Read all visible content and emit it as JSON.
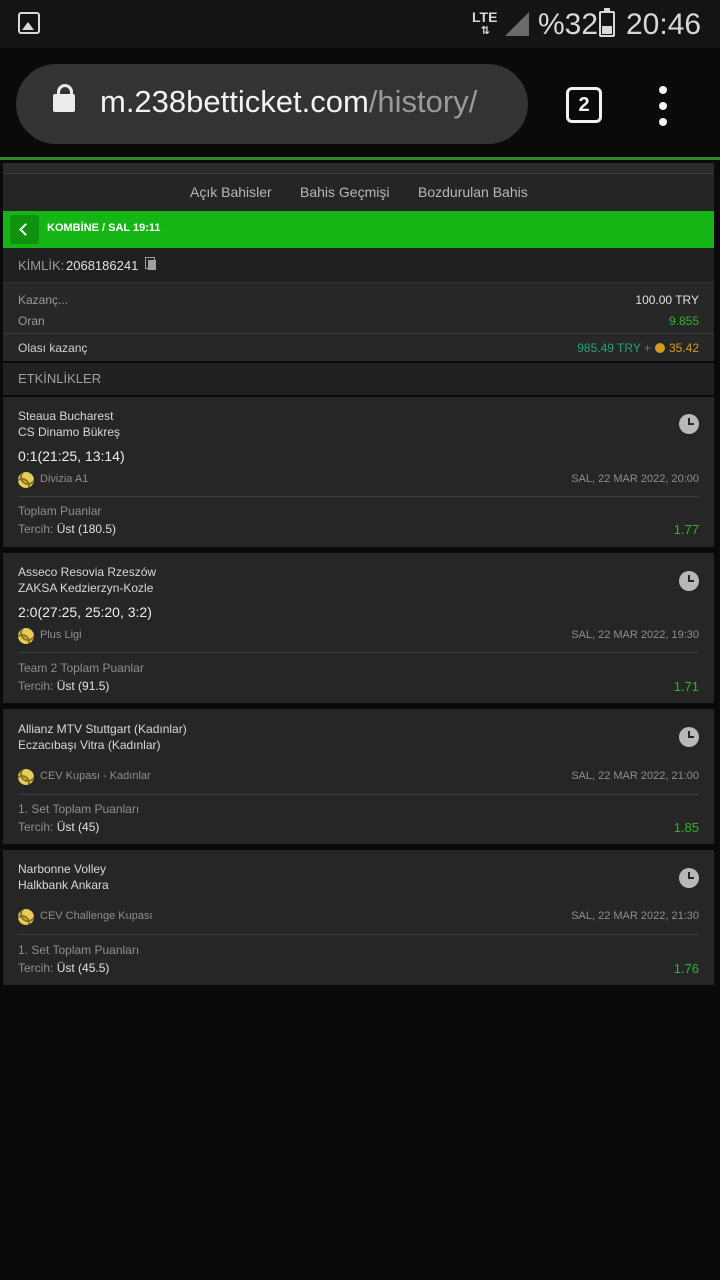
{
  "status_bar": {
    "network": "LTE",
    "battery": "%32",
    "time": "20:46",
    "icons": [
      "image-icon",
      "data-arrows-icon",
      "signal-icon",
      "battery-icon"
    ]
  },
  "browser": {
    "url_host": "m.238betticket.com",
    "url_path": "/history/",
    "tab_count": "2",
    "icons": [
      "lock-icon",
      "tabs-icon",
      "menu-dots-icon"
    ]
  },
  "nav": {
    "tabs": [
      "Açık Bahisler",
      "Bahis Geçmişi",
      "Bozdurulan Bahis"
    ]
  },
  "header": {
    "title": "KOMBİNE / SAL 19:11",
    "back_icon": "chevron-left-icon",
    "color": "#16b516"
  },
  "ticket": {
    "id_label": "KİMLİK:",
    "id_value": "2068186241"
  },
  "summary": {
    "stake_label": "Kazanç...",
    "stake_value": "100.00 TRY",
    "odds_label": "Oran",
    "odds_value": "9.855",
    "potential_label": "Olası kazanç",
    "potential_value": "985.49 TRY +",
    "bonus_value": "35.42"
  },
  "events_header": "ETKİNLİKLER",
  "events": [
    {
      "team1": "Steaua Bucharest",
      "team2": "CS Dinamo Bükreş",
      "score": "0:1(21:25, 13:14)",
      "league": "Divizia A1",
      "date": "SAL, 22 MAR 2022, 20:00",
      "market": "Toplam Puanlar",
      "pick_label": "Tercih:",
      "pick_value": "Üst (180.5)",
      "odd": "1.77"
    },
    {
      "team1": "Asseco Resovia Rzeszów",
      "team2": "ZAKSA Kedzierzyn-Kozle",
      "score": "2:0(27:25, 25:20, 3:2)",
      "league": "Plus Ligi",
      "date": "SAL, 22 MAR 2022, 19:30",
      "market": "Team 2 Toplam Puanlar",
      "pick_label": "Tercih:",
      "pick_value": "Üst (91.5)",
      "odd": "1.71"
    },
    {
      "team1": "Allianz MTV Stuttgart (Kadınlar)",
      "team2": "Eczacıbaşı Vitra (Kadınlar)",
      "score": "",
      "league": "CEV Kupası - Kadınlar",
      "date": "SAL, 22 MAR 2022, 21:00",
      "market": "1. Set Toplam Puanları",
      "pick_label": "Tercih:",
      "pick_value": "Üst (45)",
      "odd": "1.85"
    },
    {
      "team1": "Narbonne Volley",
      "team2": "Halkbank Ankara",
      "score": "",
      "league": "CEV Challenge Kupası",
      "date": "SAL, 22 MAR 2022, 21:30",
      "market": "1. Set Toplam Puanları",
      "pick_label": "Tercih:",
      "pick_value": "Üst (45.5)",
      "odd": "1.76"
    }
  ]
}
